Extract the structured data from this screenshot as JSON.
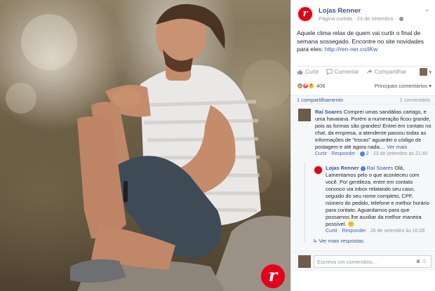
{
  "brand_badge_letter": "r",
  "post": {
    "page_name": "Lojas Renner",
    "page_type": "Página curtida",
    "date": "23 de setembro",
    "text": "Aquele clima relax de quem vai curtir o final de semana sossegado. Encontre no site novidades para eles: ",
    "link": "http://ren-ner.co/iKw",
    "actions": {
      "like": "Curtir",
      "comment": "Comentar",
      "share": "Compartilhar"
    },
    "reactions": {
      "count": "406",
      "top_comments": "Principais comentários ▾"
    },
    "shares": "1 compartilhamento",
    "comment_count": "1 comentário"
  },
  "comments": [
    {
      "author": "Raí Soares",
      "text": "Comprei umas sandálias cartago, e uma havaiana. Porém a numeração ficou grande, pois as formas são grandes! Entrei em contato no chat, da empresa, a atendente passou todas as informações de \"trocas\" aguardei o código de postagem e até agora nada.... ",
      "see_more": "Ver mais",
      "like": "Curtir",
      "reply": "Responder",
      "reply_count": "2",
      "time": "23 de setembro às 21:40"
    },
    {
      "author": "Lojas Renner",
      "mention": "Raí Soares",
      "text": "Olá, Lamentamos pelo o que aconteceu com você. Por gentileza, entre em contato conosco via inbox relatando seu caso, seguido do seu nome completo, CPF, número do pedido, telefone e melhor horário para contato. Aguardamos para que possamos lhe auxiliar da melhor maneira possível. 🙂",
      "like": "Curtir",
      "reply": "Responder",
      "time": "26 de setembro às 10:28"
    }
  ],
  "more_replies": "Ver mais respostas",
  "write_comment_placeholder": "Escreva um comentário..."
}
